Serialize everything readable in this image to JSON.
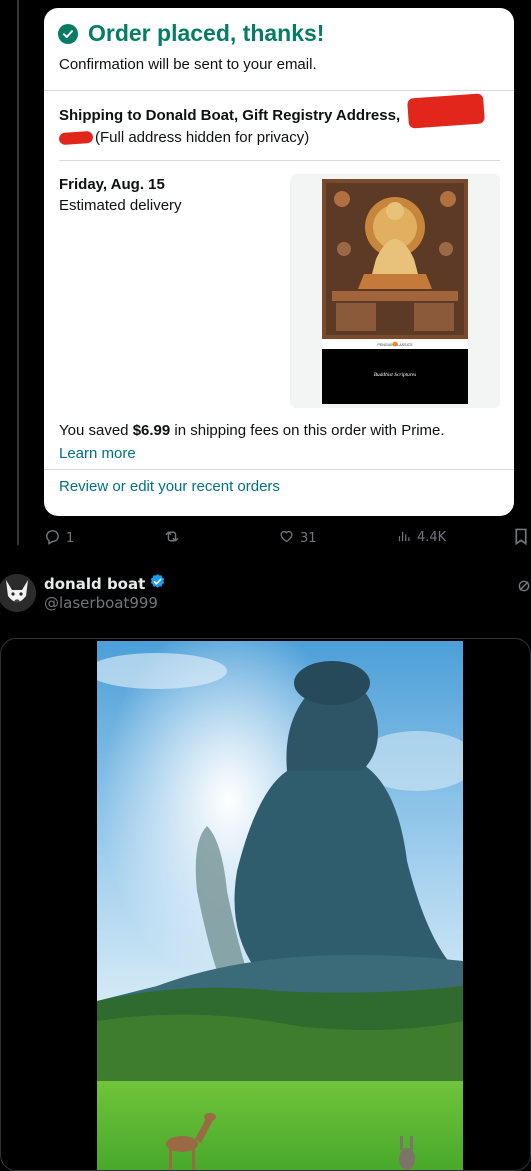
{
  "order": {
    "title": "Order placed, thanks!",
    "confirmation": "Confirmation will be sent to your email.",
    "shipping_bold": "Shipping to Donald Boat, Gift Registry Address,",
    "shipping_note": "(Full address hidden for privacy)",
    "delivery_date": "Friday, Aug. 15",
    "delivery_label": "Estimated delivery",
    "product": {
      "series": "PENGUIN   CLASSICS",
      "title": "Buddhist Scriptures"
    },
    "saved_prefix": "You saved ",
    "saved_amount": "$6.99",
    "saved_suffix": " in shipping fees on this order with Prime.",
    "learn_more": "Learn more",
    "review_link": "Review or edit your recent orders"
  },
  "post_actions": {
    "replies": "1",
    "reposts": "",
    "likes": "31",
    "views": "4.4K"
  },
  "next_post": {
    "author_name": "donald boat",
    "handle": "@laserboat999",
    "verified": true
  },
  "icons": [
    "check-icon",
    "reply-icon",
    "repost-icon",
    "like-icon",
    "views-icon",
    "bookmark-icon",
    "verified-icon",
    "more-icon"
  ],
  "colors": {
    "amazon_green": "#067d62",
    "amazon_link": "#007185",
    "verified_blue": "#1d9bf0",
    "x_gray": "#71767b"
  }
}
